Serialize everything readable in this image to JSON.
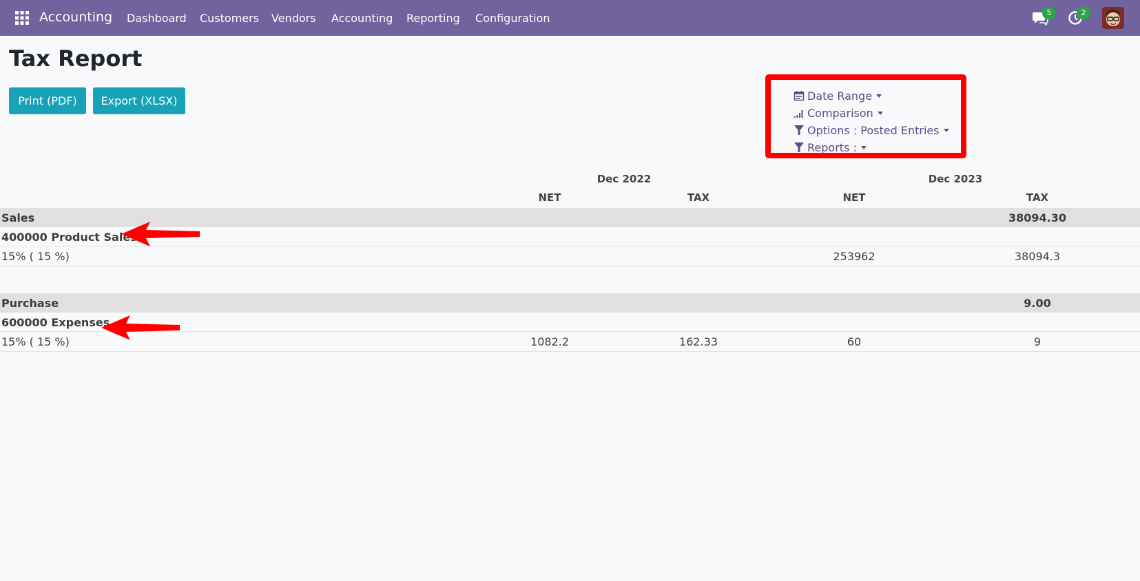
{
  "navbar": {
    "app_name": "Accounting",
    "menu": [
      "Dashboard",
      "Customers",
      "Vendors",
      "Accounting",
      "Reporting",
      "Configuration"
    ],
    "messages_count": "5",
    "activities_count": "2",
    "color": "#71639e"
  },
  "page": {
    "title": "Tax Report",
    "print_button": "Print (PDF)",
    "export_button": "Export (XLSX)"
  },
  "filters": {
    "date_range": "Date Range",
    "comparison": "Comparison",
    "options": "Options : Posted Entries",
    "reports": "Reports :"
  },
  "table": {
    "period_headers": [
      "Dec 2022",
      "Dec 2023"
    ],
    "column_headers": [
      "NET",
      "TAX",
      "NET",
      "TAX"
    ],
    "rows": [
      {
        "label": "Sales",
        "type": "section",
        "values": [
          "",
          "",
          "",
          "38094.30"
        ]
      },
      {
        "label": "400000 Product Sales",
        "type": "group",
        "values": [
          "",
          "",
          "",
          ""
        ]
      },
      {
        "label": "15% ( 15 %)",
        "type": "line",
        "values": [
          "",
          "",
          "253962",
          "38094.3"
        ]
      },
      {
        "label": "Purchase",
        "type": "section",
        "values": [
          "",
          "",
          "",
          "9.00"
        ]
      },
      {
        "label": "600000 Expenses",
        "type": "group",
        "values": [
          "",
          "",
          "",
          ""
        ]
      },
      {
        "label": "15% ( 15 %)",
        "type": "line",
        "values": [
          "1082.2",
          "162.33",
          "60",
          "9"
        ]
      }
    ]
  },
  "colors": {
    "accent": "#17a2b8",
    "highlight": "#ff0000",
    "section_bg": "#e0e0e0"
  }
}
